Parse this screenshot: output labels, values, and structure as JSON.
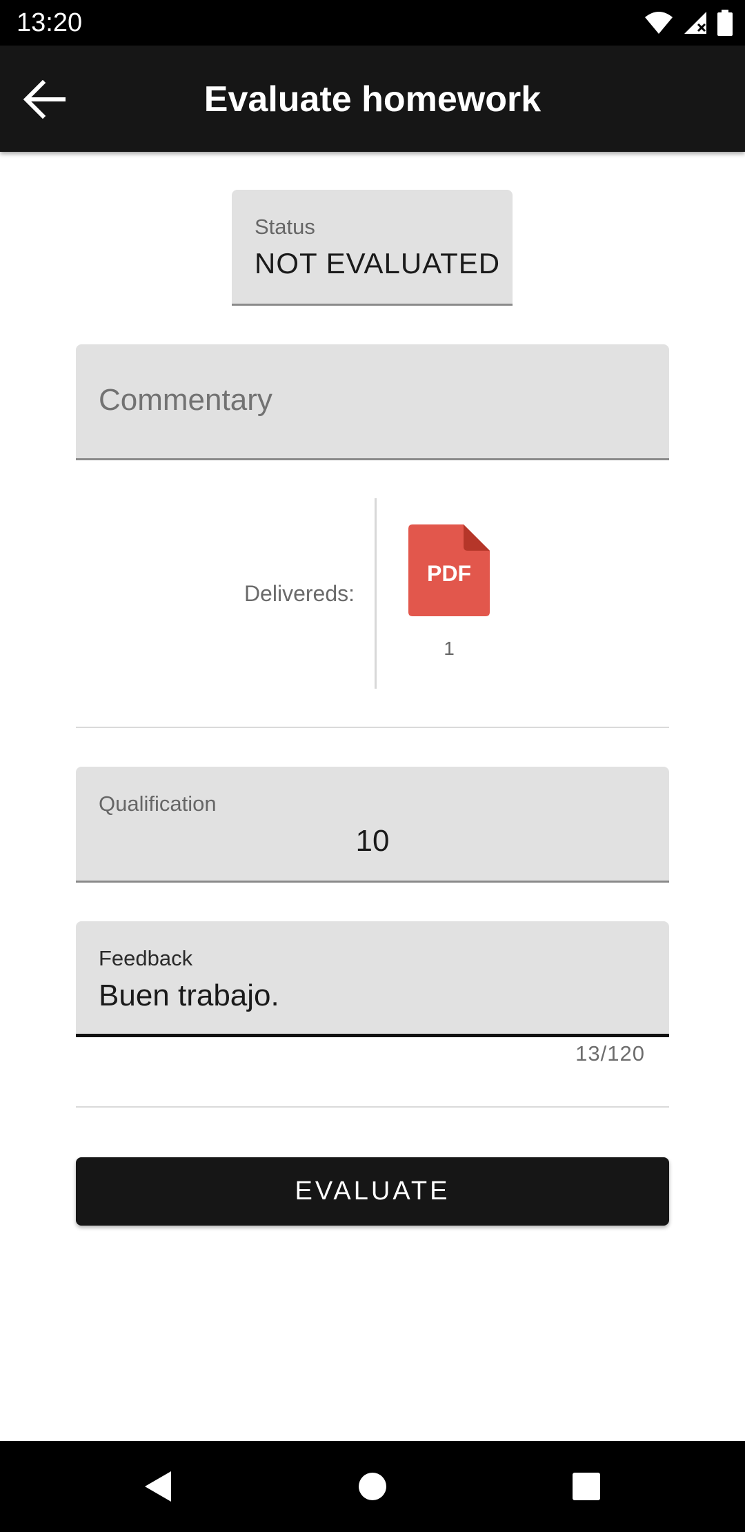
{
  "status_bar": {
    "time": "13:20",
    "icons": [
      "wifi-icon",
      "signal-icon",
      "battery-icon"
    ]
  },
  "app_bar": {
    "title": "Evaluate homework",
    "back_icon": "arrow-back-icon"
  },
  "status_field": {
    "label": "Status",
    "value": "NOT EVALUATED"
  },
  "commentary_field": {
    "placeholder": "Commentary",
    "value": ""
  },
  "delivered": {
    "label": "Delivereds:",
    "files": [
      {
        "type_label": "PDF",
        "count": "1",
        "icon": "pdf-file-icon"
      }
    ]
  },
  "qualification_field": {
    "label": "Qualification",
    "value": "10"
  },
  "feedback_field": {
    "label": "Feedback",
    "value": "Buen trabajo.",
    "counter": "13/120"
  },
  "actions": {
    "evaluate_label": "EVALUATE"
  },
  "colors": {
    "app_bar": "#161616",
    "field_bg": "#e1e1e1",
    "pdf_red": "#e2574c",
    "pdf_fold": "#b53629",
    "button_bg": "#161616"
  }
}
